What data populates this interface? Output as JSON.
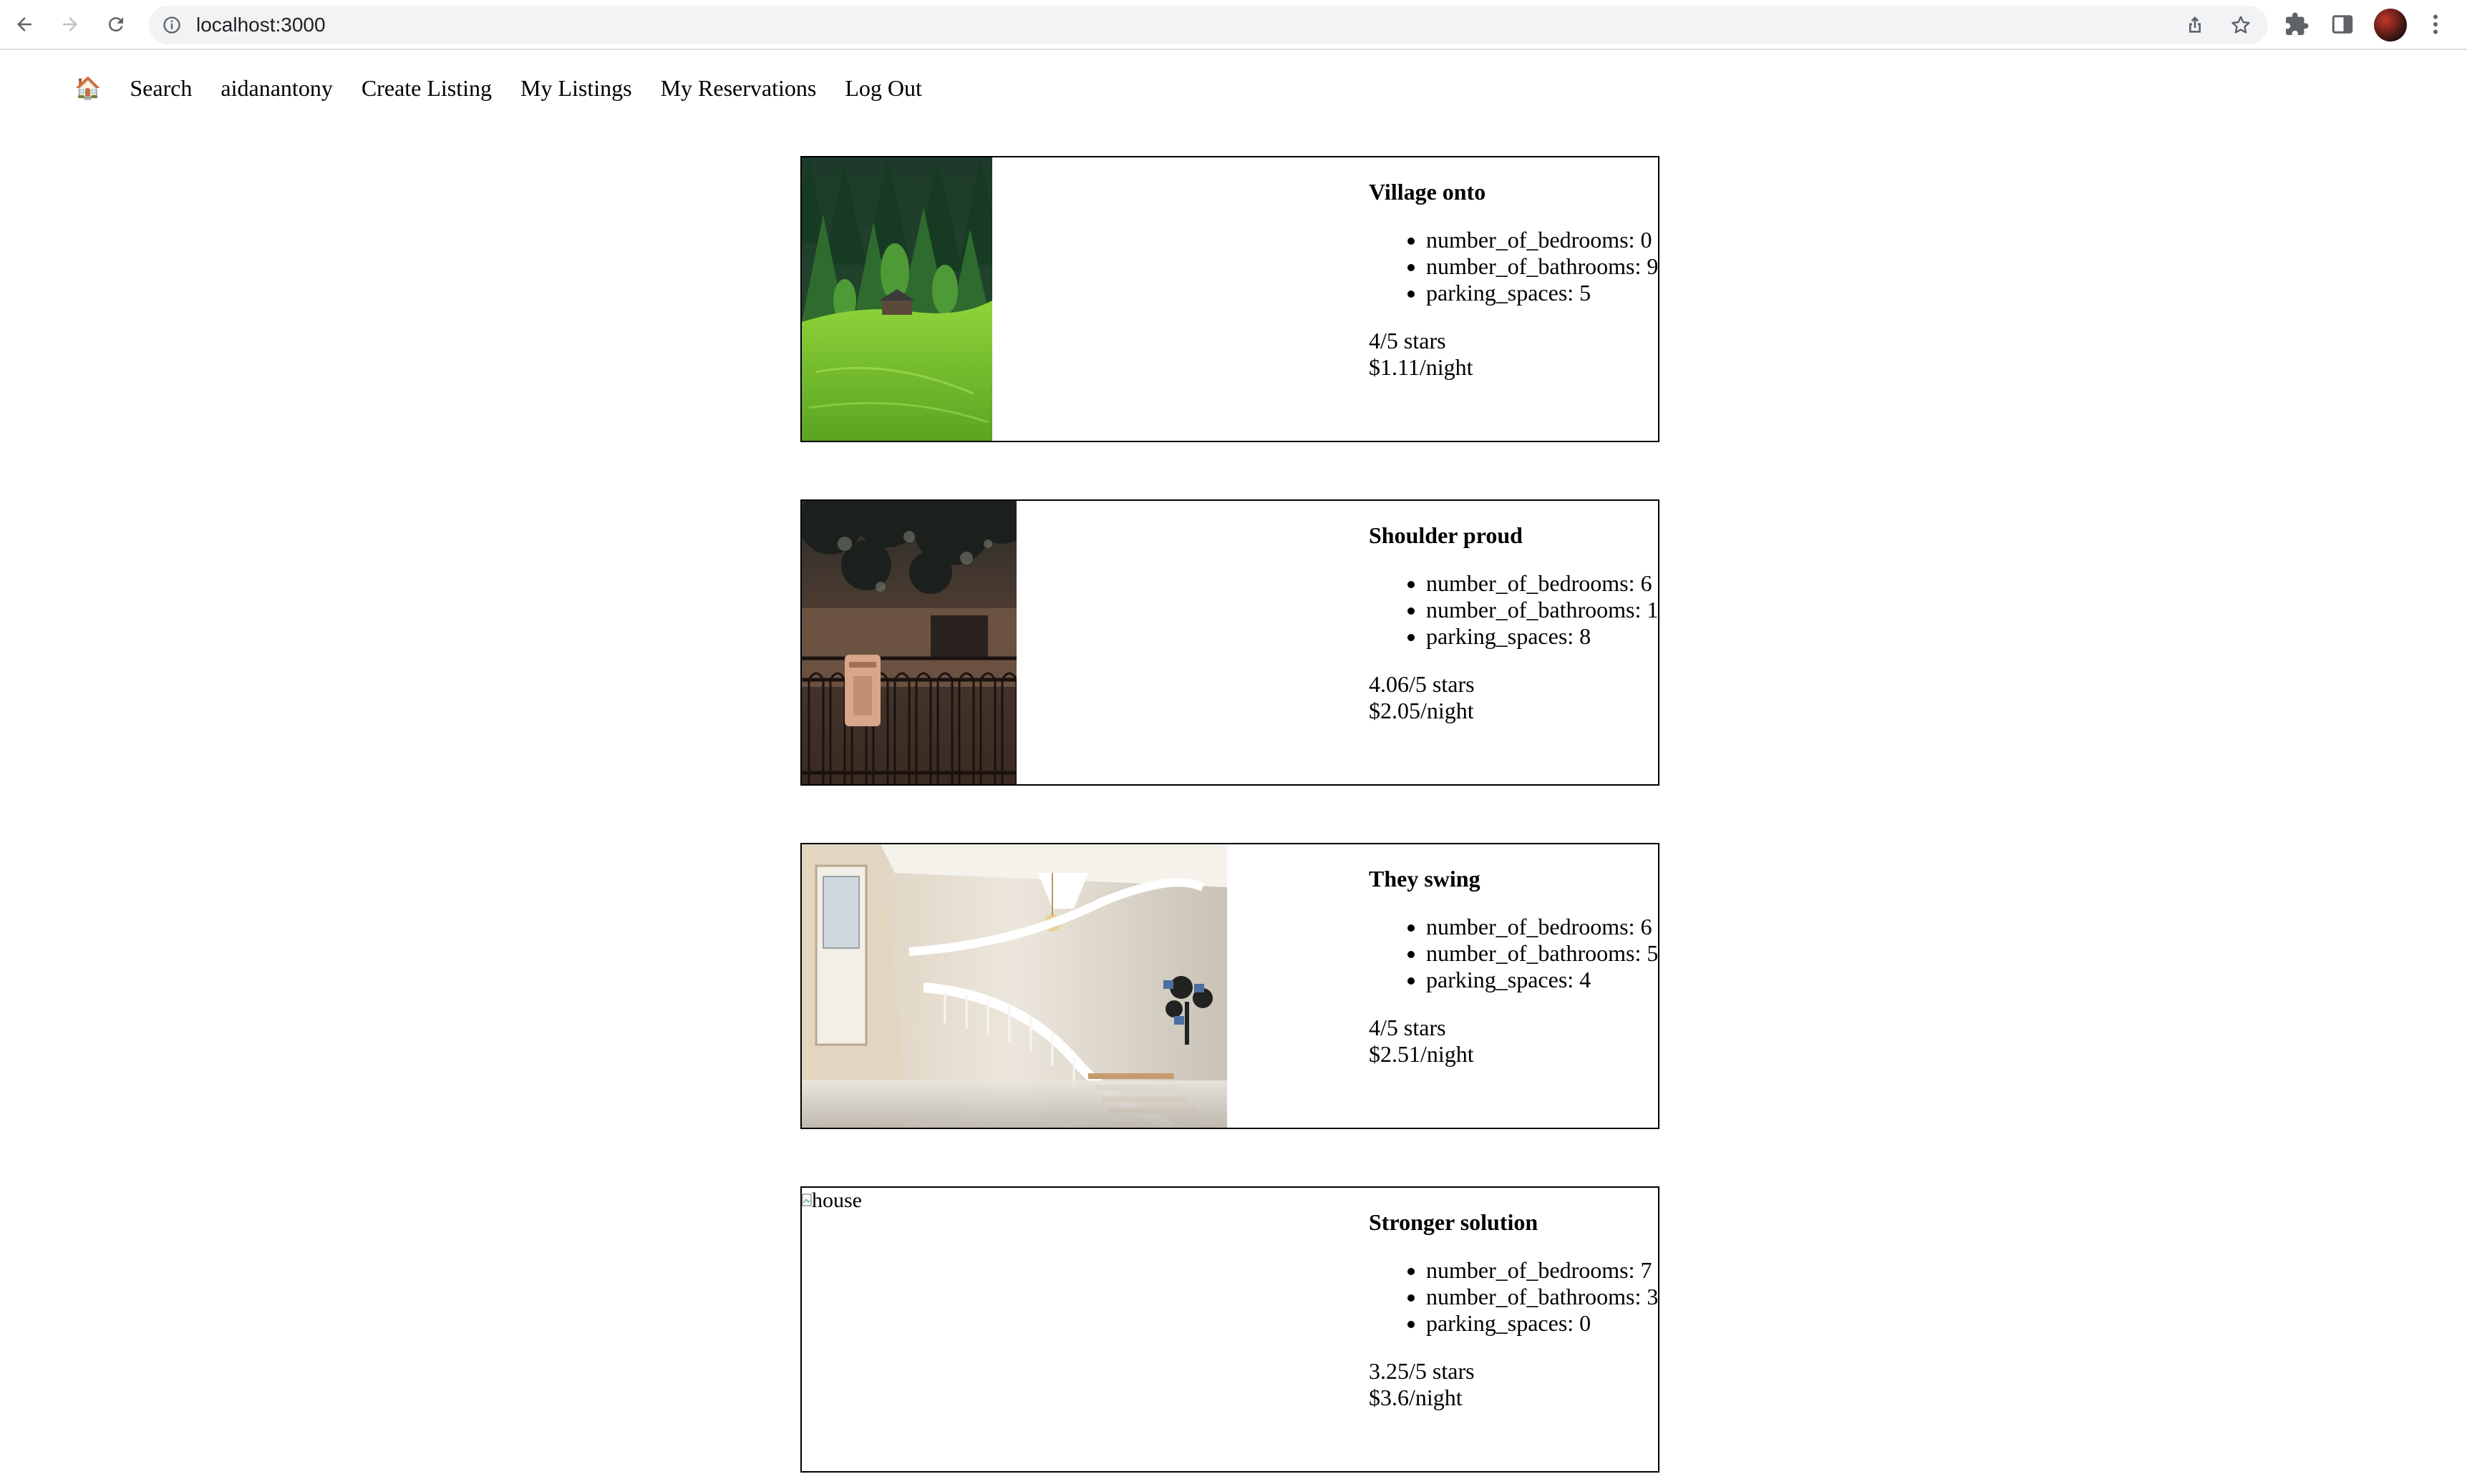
{
  "browser": {
    "url": "localhost:3000"
  },
  "nav": {
    "home_icon": "🏠",
    "search": "Search",
    "username": "aidanantony",
    "create_listing": "Create Listing",
    "my_listings": "My Listings",
    "my_reservations": "My Reservations",
    "log_out": "Log Out"
  },
  "listings": [
    {
      "title": "Village onto",
      "bedrooms": "number_of_bedrooms: 0",
      "bathrooms": "number_of_bathrooms: 9",
      "parking": "parking_spaces: 5",
      "rating": "4/5 stars",
      "price": "$1.11/night",
      "image": "forest-hillside-cabin-photo"
    },
    {
      "title": "Shoulder proud",
      "bedrooms": "number_of_bedrooms: 6",
      "bathrooms": "number_of_bathrooms: 1",
      "parking": "parking_spaces: 8",
      "rating": "4.06/5 stars",
      "price": "$2.05/night",
      "image": "iron-gate-mailbox-photo"
    },
    {
      "title": "They swing",
      "bedrooms": "number_of_bedrooms: 6",
      "bathrooms": "number_of_bathrooms: 5",
      "parking": "parking_spaces: 4",
      "rating": "4/5 stars",
      "price": "$2.51/night",
      "image": "interior-staircase-photo"
    },
    {
      "title": "Stronger solution",
      "bedrooms": "number_of_bedrooms: 7",
      "bathrooms": "number_of_bathrooms: 3",
      "parking": "parking_spaces: 0",
      "rating": "3.25/5 stars",
      "price": "$3.6/night",
      "image_alt": "house"
    }
  ]
}
